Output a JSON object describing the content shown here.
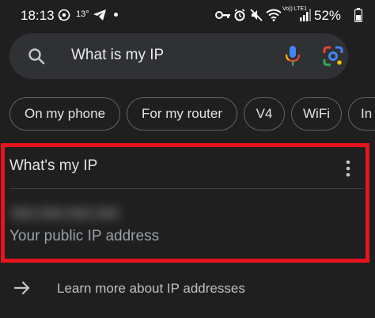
{
  "status_bar": {
    "time": "18:13",
    "temperature": "13°",
    "network_label": "Vo)) LTE1",
    "battery_percent": "52%",
    "icons": [
      "whatsapp-icon",
      "telegram-icon",
      "notification-dot",
      "key-icon",
      "alarm-icon",
      "mute-icon",
      "wifi-icon",
      "cell-signal-icon",
      "battery-icon"
    ]
  },
  "search": {
    "query": "What is my IP",
    "icons": [
      "search-icon",
      "mic-icon",
      "lens-icon"
    ]
  },
  "chips": [
    "On my phone",
    "For my router",
    "V4",
    "WiFi",
    "In"
  ],
  "result_card": {
    "title": "What's my IP",
    "ip_value": "xxx.xxx.xxx.xxx",
    "caption": "Your public IP address",
    "highlight_color": "#e8141d"
  },
  "learn_more": {
    "label": "Learn more about IP addresses"
  },
  "colors": {
    "background": "#1f1f1f",
    "search_bar": "#303134",
    "chip_border": "#5f6368"
  }
}
